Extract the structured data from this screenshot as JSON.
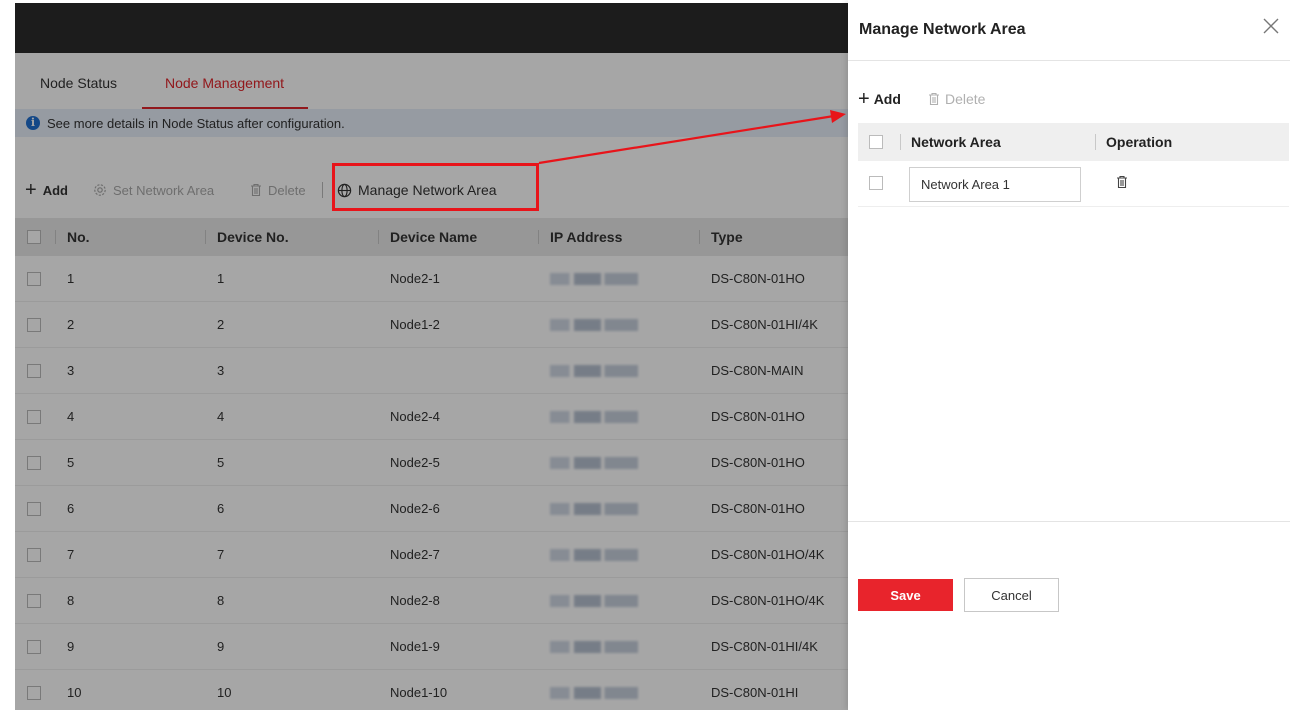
{
  "tabs": [
    {
      "label": "Node Status",
      "active": false
    },
    {
      "label": "Node Management",
      "active": true
    }
  ],
  "tip": {
    "icon": "info-icon",
    "text": "See more details in Node Status after configuration."
  },
  "toolbar": {
    "add_label": "Add",
    "set_area_label": "Set Network Area",
    "delete_label": "Delete",
    "manage_label": "Manage Network Area"
  },
  "table": {
    "headers": [
      "No.",
      "Device No.",
      "Device Name",
      "IP Address",
      "Type"
    ],
    "rows": [
      {
        "no": "1",
        "device_no": "1",
        "name": "Node2-1",
        "type": "DS-C80N-01HO"
      },
      {
        "no": "2",
        "device_no": "2",
        "name": "Node1-2",
        "type": "DS-C80N-01HI/4K"
      },
      {
        "no": "3",
        "device_no": "3",
        "name": "",
        "type": "DS-C80N-MAIN"
      },
      {
        "no": "4",
        "device_no": "4",
        "name": "Node2-4",
        "type": "DS-C80N-01HO"
      },
      {
        "no": "5",
        "device_no": "5",
        "name": "Node2-5",
        "type": "DS-C80N-01HO"
      },
      {
        "no": "6",
        "device_no": "6",
        "name": "Node2-6",
        "type": "DS-C80N-01HO"
      },
      {
        "no": "7",
        "device_no": "7",
        "name": "Node2-7",
        "type": "DS-C80N-01HO/4K"
      },
      {
        "no": "8",
        "device_no": "8",
        "name": "Node2-8",
        "type": "DS-C80N-01HO/4K"
      },
      {
        "no": "9",
        "device_no": "9",
        "name": "Node1-9",
        "type": "DS-C80N-01HI/4K"
      },
      {
        "no": "10",
        "device_no": "10",
        "name": "Node1-10",
        "type": "DS-C80N-01HI"
      }
    ]
  },
  "drawer": {
    "title": "Manage Network Area",
    "add_label": "Add",
    "delete_label": "Delete",
    "headers": {
      "area": "Network Area",
      "operation": "Operation"
    },
    "row": {
      "area_value": "Network Area 1"
    },
    "save_label": "Save",
    "cancel_label": "Cancel"
  },
  "colors": {
    "accent": "#e0262b",
    "highlight": "#e8141a",
    "save_button": "#e8242c"
  }
}
